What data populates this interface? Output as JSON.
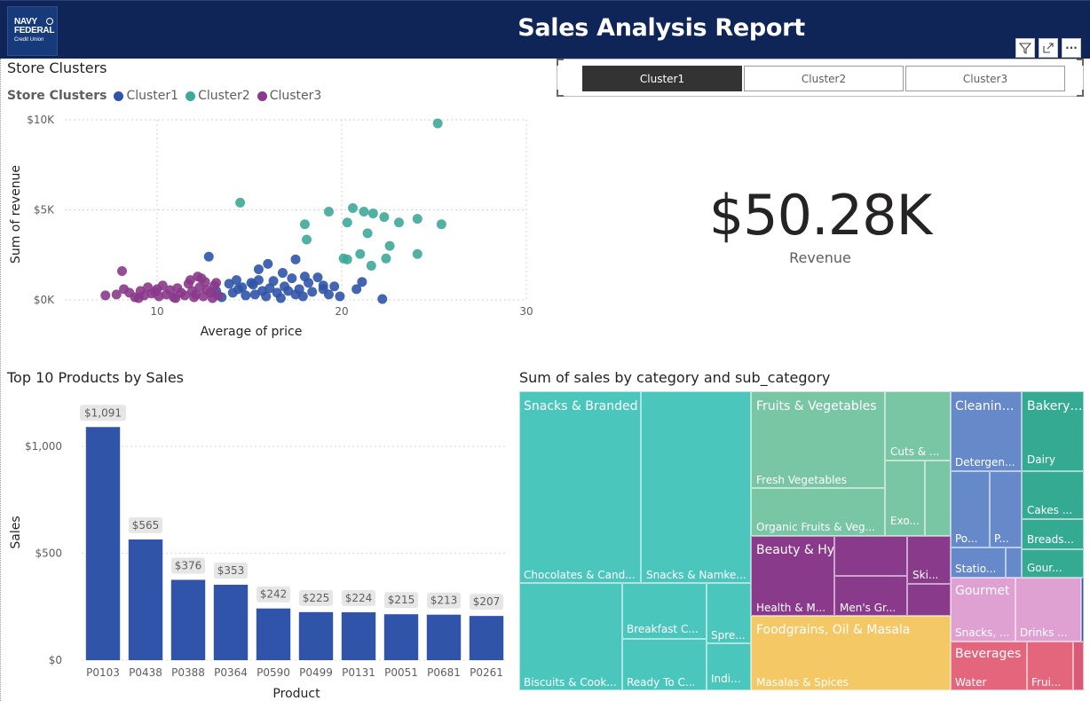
{
  "header": {
    "logo_line1": "NAVY",
    "logo_line2": "FEDERAL",
    "logo_line3": "Credit Union",
    "title": "Sales Analysis Report",
    "background_color": "#0f2557"
  },
  "toolbar": {
    "icons": [
      "filter-icon",
      "focus-mode-icon",
      "more-options-icon"
    ],
    "more_label": "···"
  },
  "scatter": {
    "title": "Store Clusters",
    "legend_title": "Store Clusters",
    "legend": [
      {
        "name": "Cluster1",
        "color": "#3054a9"
      },
      {
        "name": "Cluster2",
        "color": "#3ea899"
      },
      {
        "name": "Cluster3",
        "color": "#8a3a8a"
      }
    ]
  },
  "slicer": {
    "options": [
      "Cluster1",
      "Cluster2",
      "Cluster3"
    ],
    "selected": "Cluster1"
  },
  "kpi": {
    "value": "$50.28K",
    "label": "Revenue"
  },
  "bar": {
    "title": "Top 10 Products by Sales",
    "color": "#3054a9"
  },
  "treemap": {
    "title": "Sum of sales by category and sub_category",
    "colors": {
      "snacks": "#4ac6bc",
      "fruits": "#79c6a5",
      "cleaning": "#6689c9",
      "bakery": "#35aa92",
      "beauty": "#8a3a8a",
      "foodgrains": "#f4c864",
      "gourmet": "#dfa1d2",
      "beverages": "#e3667d"
    },
    "labels": {
      "snacks_cat": "Snacks & Branded Foods",
      "chocolates": "Chocolates & Cand...",
      "namkeen": "Snacks & Namke...",
      "biscuits": "Biscuits & Cook...",
      "breakfast": "Breakfast C...",
      "ready": "Ready To C...",
      "spreads": "Spre...",
      "indian": "Indi...",
      "fruits_cat": "Fruits & Vegetables",
      "fresh": "Fresh Vegetables",
      "organic": "Organic Fruits & Veg...",
      "cuts": "Cuts & ...",
      "exotic": "Exo...",
      "beauty_cat": "Beauty & Hygiene",
      "health": "Health & M...",
      "mens": "Men's Gr...",
      "skin": "Ski...",
      "foodgrains_cat": "Foodgrains, Oil & Masala",
      "masalas": "Masalas & Spices",
      "cleaning_cat": "Cleaning...",
      "detergents": "Detergen...",
      "po": "Po...",
      "p": "P...",
      "stationery": "Statio...",
      "bakery_cat": "Bakery,...",
      "dairy": "Dairy",
      "cakes": "Cakes ...",
      "breads": "Breads...",
      "gour": "Gour...",
      "gourmet_cat": "Gourmet & World ...",
      "gsnacks": "Snacks, ...",
      "drinks": "Drinks ...",
      "beverages_cat": "Beverages",
      "water": "Water",
      "frui": "Frui..."
    }
  },
  "chart_data": [
    {
      "type": "scatter",
      "title": "Store Clusters",
      "xlabel": "Average of price",
      "ylabel": "Sum of revenue",
      "xlim": [
        5,
        30
      ],
      "ylim": [
        0,
        10000
      ],
      "x_ticks": [
        "10",
        "20",
        "30"
      ],
      "y_ticks": [
        "$0K",
        "$5K",
        "$10K"
      ],
      "grid": true,
      "legend_position": "top-left",
      "series": [
        {
          "name": "Cluster1",
          "color": "#3054a9",
          "points": [
            [
              13.2,
              500
            ],
            [
              13.5,
              150
            ],
            [
              13.9,
              900
            ],
            [
              14.1,
              400
            ],
            [
              14.4,
              600
            ],
            [
              14.6,
              700
            ],
            [
              14.8,
              250
            ],
            [
              15.1,
              950
            ],
            [
              15.3,
              300
            ],
            [
              15.5,
              1100
            ],
            [
              15.7,
              500
            ],
            [
              15.9,
              200
            ],
            [
              16.1,
              650
            ],
            [
              16.3,
              1050
            ],
            [
              16.5,
              400
            ],
            [
              16.7,
              100
            ],
            [
              16.9,
              750
            ],
            [
              17.1,
              500
            ],
            [
              17.3,
              1200
            ],
            [
              17.5,
              300
            ],
            [
              17.7,
              600
            ],
            [
              17.9,
              200
            ],
            [
              18.2,
              950
            ],
            [
              18.4,
              450
            ],
            [
              18.7,
              1250
            ],
            [
              19,
              600
            ],
            [
              19.3,
              300
            ],
            [
              19.6,
              750
            ],
            [
              19.9,
              200
            ],
            [
              16,
              2000
            ],
            [
              16.8,
              1500
            ],
            [
              17.5,
              2250
            ],
            [
              18,
              1300
            ],
            [
              19,
              800
            ],
            [
              15.5,
              1700
            ],
            [
              14.3,
              1100
            ],
            [
              12.8,
              2400
            ],
            [
              22.2,
              50
            ],
            [
              20.8,
              600
            ],
            [
              21.1,
              1000
            ],
            [
              15.2,
              850
            ]
          ]
        },
        {
          "name": "Cluster2",
          "color": "#3ea899",
          "points": [
            [
              25.2,
              9800
            ],
            [
              14.5,
              5400
            ],
            [
              18.0,
              4200
            ],
            [
              18.1,
              3350
            ],
            [
              19.3,
              4900
            ],
            [
              20.3,
              4300
            ],
            [
              20.6,
              5100
            ],
            [
              21.2,
              4900
            ],
            [
              21.4,
              3700
            ],
            [
              21.7,
              4800
            ],
            [
              22.3,
              4600
            ],
            [
              22.6,
              3000
            ],
            [
              23.1,
              4300
            ],
            [
              24.1,
              4500
            ],
            [
              25.4,
              4200
            ],
            [
              24.1,
              2550
            ],
            [
              22.4,
              2300
            ],
            [
              21.6,
              1900
            ],
            [
              20.1,
              2300
            ],
            [
              20.3,
              2250
            ],
            [
              21.0,
              2550
            ]
          ]
        },
        {
          "name": "Cluster3",
          "color": "#8a3a8a",
          "points": [
            [
              7.2,
              250
            ],
            [
              7.8,
              300
            ],
            [
              8.2,
              600
            ],
            [
              8.5,
              400
            ],
            [
              8.8,
              150
            ],
            [
              9.1,
              500
            ],
            [
              9.3,
              250
            ],
            [
              9.5,
              700
            ],
            [
              9.7,
              350
            ],
            [
              9.9,
              450
            ],
            [
              10.1,
              200
            ],
            [
              10.3,
              800
            ],
            [
              10.5,
              300
            ],
            [
              10.7,
              550
            ],
            [
              10.9,
              150
            ],
            [
              11.1,
              650
            ],
            [
              11.3,
              400
            ],
            [
              11.5,
              250
            ],
            [
              11.7,
              900
            ],
            [
              11.9,
              500
            ],
            [
              12.1,
              300
            ],
            [
              12.3,
              700
            ],
            [
              12.5,
              200
            ],
            [
              12.7,
              550
            ],
            [
              12.9,
              400
            ],
            [
              13.1,
              800
            ],
            [
              13.3,
              250
            ],
            [
              12.2,
              1300
            ],
            [
              11.8,
              1100
            ],
            [
              12.6,
              1000
            ],
            [
              8.1,
              1600
            ],
            [
              10.0,
              600
            ],
            [
              11.0,
              100
            ],
            [
              12.0,
              150
            ],
            [
              13.0,
              100
            ],
            [
              9.0,
              100
            ],
            [
              12.4,
              1200
            ],
            [
              13.2,
              950
            ]
          ]
        }
      ]
    },
    {
      "type": "bar",
      "title": "Top 10 Products by Sales",
      "xlabel": "Product",
      "ylabel": "Sales",
      "ylim": [
        0,
        1200
      ],
      "y_ticks": [
        "$0",
        "$500",
        "$1,000"
      ],
      "categories": [
        "P0103",
        "P0438",
        "P0388",
        "P0364",
        "P0590",
        "P0499",
        "P0131",
        "P0051",
        "P0681",
        "P0261"
      ],
      "values": [
        1091,
        565,
        376,
        353,
        242,
        225,
        224,
        215,
        213,
        207
      ],
      "data_labels": [
        "$1,091",
        "$565",
        "$376",
        "$353",
        "$242",
        "$225",
        "$224",
        "$215",
        "$213",
        "$207"
      ],
      "grid": true
    }
  ]
}
